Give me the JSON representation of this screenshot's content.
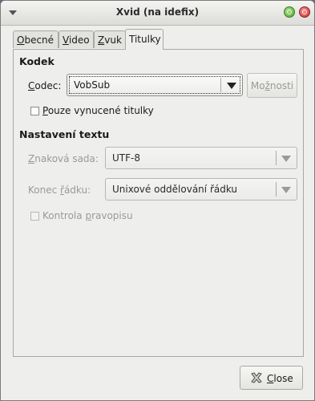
{
  "window": {
    "title": "Xvid (na idefix)"
  },
  "tabs": [
    {
      "label_u": "O",
      "label_rest": "becné"
    },
    {
      "label_u": "V",
      "label_rest": "ideo"
    },
    {
      "label_u": "Z",
      "label_rest": "vuk"
    },
    {
      "label": "Titulky"
    }
  ],
  "kodek": {
    "title": "Kodek",
    "codec_label_u": "C",
    "codec_label_rest": "odec:",
    "codec_value": "VobSub",
    "options_pre": "Mo",
    "options_u": "ž",
    "options_post": "nosti",
    "forced_u": "P",
    "forced_rest": "ouze vynucené titulky"
  },
  "text_settings": {
    "title": "Nastavení textu",
    "charset_label_u": "Z",
    "charset_label_rest": "naková sada:",
    "charset_value": "UTF-8",
    "lineend_label_pre": "Konec ",
    "lineend_label_u": "ř",
    "lineend_label_post": "ádku:",
    "lineend_value": "Unixové oddělování řádku",
    "spell_pre": "Kontrola ",
    "spell_u": "p",
    "spell_post": "ravopisu"
  },
  "footer": {
    "close_u": "C",
    "close_rest": "lose"
  },
  "colors": {
    "close_icon": "#555555",
    "min_button": "#4fa52c",
    "close_button": "#cc2a2a"
  }
}
